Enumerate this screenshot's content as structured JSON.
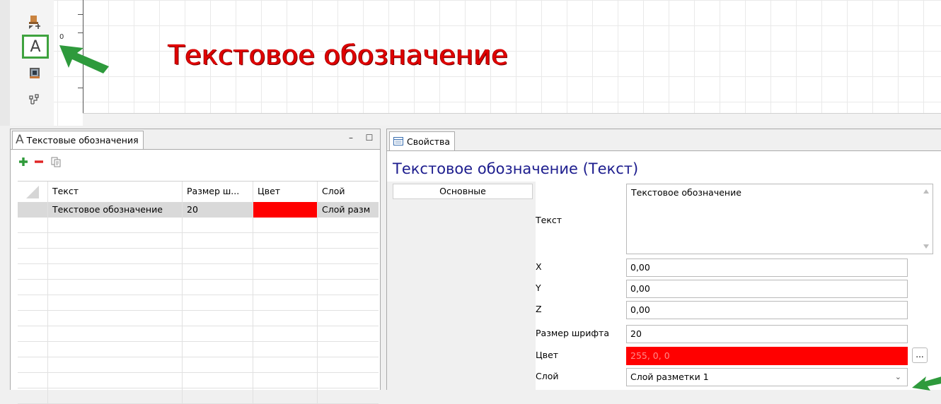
{
  "colors": {
    "highlight_border": "#3ea23e",
    "arrow": "#2e9a3c",
    "big_text": "#e10000",
    "color_swatch": "#ff0000",
    "props_title": "#1d1d8e"
  },
  "canvas": {
    "ruler_zero": "0",
    "big_text": "Текстовое обозначение",
    "tools": [
      "layout-tool-icon",
      "text-tool-icon",
      "equipment-tool-icon",
      "network-tool-icon"
    ],
    "text_tool_glyph": "A"
  },
  "left_panel": {
    "tab_icon": "A",
    "tab_label": "Текстовые обозначения",
    "minimize": "–",
    "maximize": "☐",
    "toolbar": [
      "add-icon",
      "remove-icon",
      "copy-icon"
    ],
    "columns": [
      "Текст",
      "Размер ш...",
      "Цвет",
      "Слой"
    ],
    "rows": [
      {
        "text": "Текстовое обозначение",
        "size": "20",
        "color": "#ff0000",
        "layer": "Слой разм"
      }
    ]
  },
  "right_panel": {
    "tab_label": "Свойства",
    "title": "Текстовое обозначение (Текст)",
    "section_button": "Основные",
    "props": {
      "text_label": "Текст",
      "text_value": "Текстовое обозначение",
      "x_label": "X",
      "x_value": "0,00",
      "y_label": "Y",
      "y_value": "0,00",
      "z_label": "Z",
      "z_value": "0,00",
      "font_size_label": "Размер шрифта",
      "font_size_value": "20",
      "color_label": "Цвет",
      "color_value": "255, 0, 0",
      "color_button": "...",
      "layer_label": "Слой",
      "layer_value": "Слой разметки 1"
    }
  }
}
